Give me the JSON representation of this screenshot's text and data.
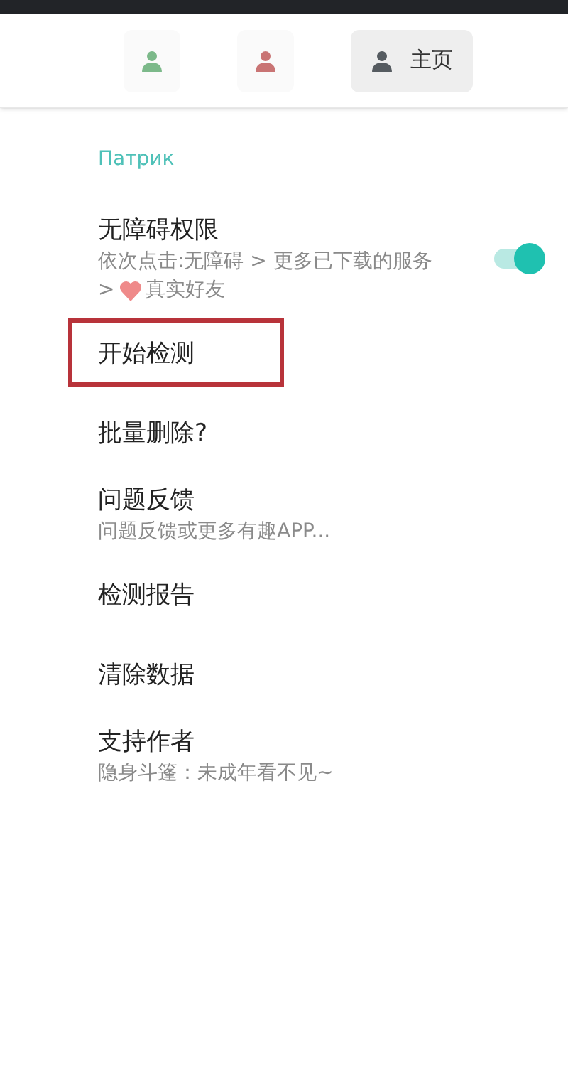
{
  "tabs": [
    {
      "kind": "green",
      "selected": false
    },
    {
      "kind": "red",
      "selected": false
    },
    {
      "kind": "home",
      "label": "主页",
      "selected": true
    }
  ],
  "section": {
    "title": "Патрик"
  },
  "items": [
    {
      "title": "无障碍权限",
      "subtitle_lines": [
        [
          {
            "kind": "text",
            "text": "依次点击:无障碍 > 更多已下载的服务"
          }
        ],
        [
          {
            "kind": "text",
            "text": ">"
          },
          {
            "kind": "heart"
          },
          {
            "kind": "text",
            "text": "真实好友"
          }
        ]
      ],
      "toggle": {
        "on": true
      }
    },
    {
      "title": "开始检测",
      "highlighted": true
    },
    {
      "title": "批量删除?"
    },
    {
      "title": "问题反馈",
      "subtitle_lines": [
        [
          {
            "kind": "text",
            "text": "问题反馈或更多有趣APP..."
          }
        ]
      ]
    },
    {
      "title": "检测报告"
    },
    {
      "title": "清除数据"
    },
    {
      "title": "支持作者",
      "subtitle_lines": [
        [
          {
            "kind": "text",
            "text": "隐身斗篷：未成年看不见~"
          }
        ]
      ]
    }
  ]
}
